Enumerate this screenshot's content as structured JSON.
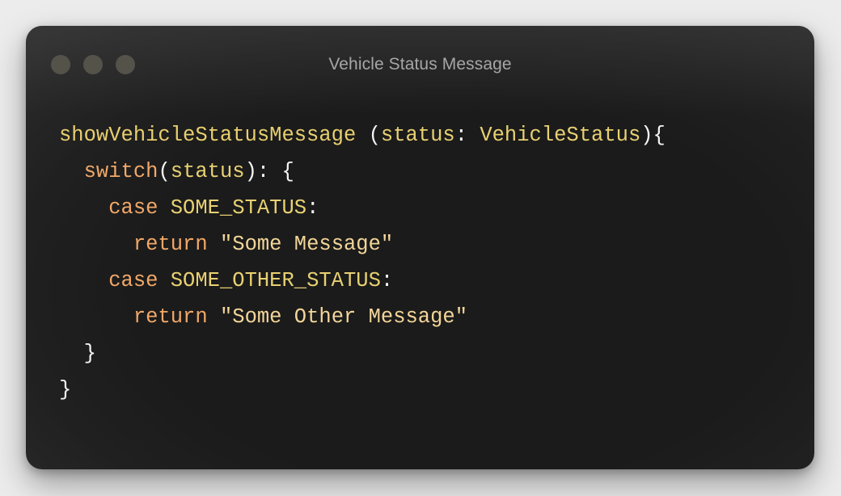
{
  "window": {
    "title": "Vehicle Status Message",
    "traffic_lights": [
      "close",
      "minimize",
      "zoom"
    ]
  },
  "code": {
    "language_style": "pseudo-typescript",
    "lines": [
      {
        "indent": "",
        "tokens": [
          {
            "type": "fn",
            "text": "showVehicleStatusMessage"
          },
          {
            "type": "punc",
            "text": " ("
          },
          {
            "type": "id",
            "text": "status"
          },
          {
            "type": "punc",
            "text": ": "
          },
          {
            "type": "id",
            "text": "VehicleStatus"
          },
          {
            "type": "punc",
            "text": "){"
          }
        ]
      },
      {
        "indent": "  ",
        "tokens": [
          {
            "type": "kw",
            "text": "switch"
          },
          {
            "type": "punc",
            "text": "("
          },
          {
            "type": "id",
            "text": "status"
          },
          {
            "type": "punc",
            "text": "): {"
          }
        ]
      },
      {
        "indent": "    ",
        "tokens": [
          {
            "type": "kw",
            "text": "case"
          },
          {
            "type": "punc",
            "text": " "
          },
          {
            "type": "id",
            "text": "SOME_STATUS"
          },
          {
            "type": "punc",
            "text": ":"
          }
        ]
      },
      {
        "indent": "      ",
        "tokens": [
          {
            "type": "kw",
            "text": "return"
          },
          {
            "type": "punc",
            "text": " "
          },
          {
            "type": "str",
            "text": "\"Some Message\""
          }
        ]
      },
      {
        "indent": "    ",
        "tokens": [
          {
            "type": "kw",
            "text": "case"
          },
          {
            "type": "punc",
            "text": " "
          },
          {
            "type": "id",
            "text": "SOME_OTHER_STATUS"
          },
          {
            "type": "punc",
            "text": ":"
          }
        ]
      },
      {
        "indent": "      ",
        "tokens": [
          {
            "type": "kw",
            "text": "return"
          },
          {
            "type": "punc",
            "text": " "
          },
          {
            "type": "str",
            "text": "\"Some Other Message\""
          }
        ]
      },
      {
        "indent": "  ",
        "tokens": [
          {
            "type": "punc",
            "text": "}"
          }
        ]
      },
      {
        "indent": "",
        "tokens": [
          {
            "type": "punc",
            "text": "}"
          }
        ]
      }
    ]
  },
  "colors": {
    "window_bg": "#1b1b1b",
    "page_bg": "#ececec",
    "title_text": "#a6a6a6",
    "traffic_light": "#55524a",
    "function_name": "#e8cf6f",
    "keyword": "#f2a868",
    "identifier": "#e8d172",
    "punctuation": "#f5f5f5",
    "string": "#f3d699"
  }
}
